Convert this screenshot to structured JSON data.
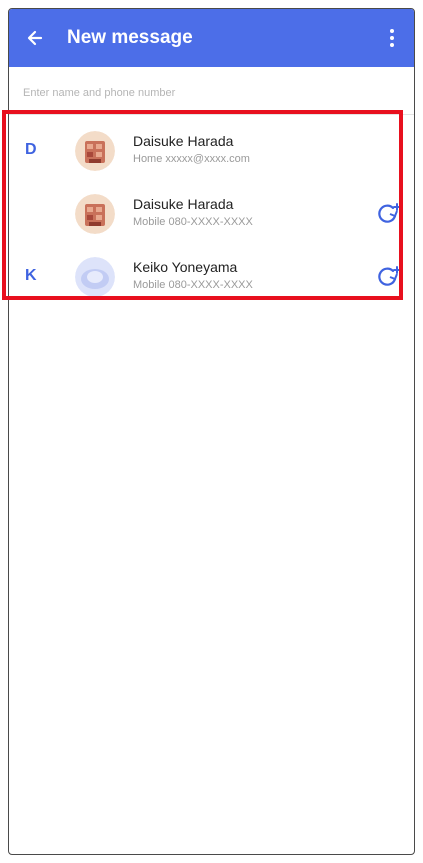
{
  "header": {
    "title": "New message",
    "back_icon": "arrow-left-icon",
    "more_icon": "more-vert-icon",
    "color": "#4c6ee8"
  },
  "search": {
    "placeholder": "Enter name and phone number",
    "value": ""
  },
  "contacts": [
    {
      "index_letter": "D",
      "name": "Daisuke Harada",
      "detail": "Home  xxxxx@xxxx.com",
      "avatar": "daisuke-photo",
      "show_action": false
    },
    {
      "index_letter": "",
      "name": "Daisuke Harada",
      "detail": "Mobile  080-XXXX-XXXX",
      "avatar": "daisuke-photo",
      "show_action": true
    },
    {
      "index_letter": "K",
      "name": "Keiko Yoneyama",
      "detail": "Mobile  080-XXXX-XXXX",
      "avatar": "keiko-photo",
      "show_action": true
    }
  ],
  "colors": {
    "accent": "#3f63e0",
    "highlight_border": "#e8101e"
  }
}
